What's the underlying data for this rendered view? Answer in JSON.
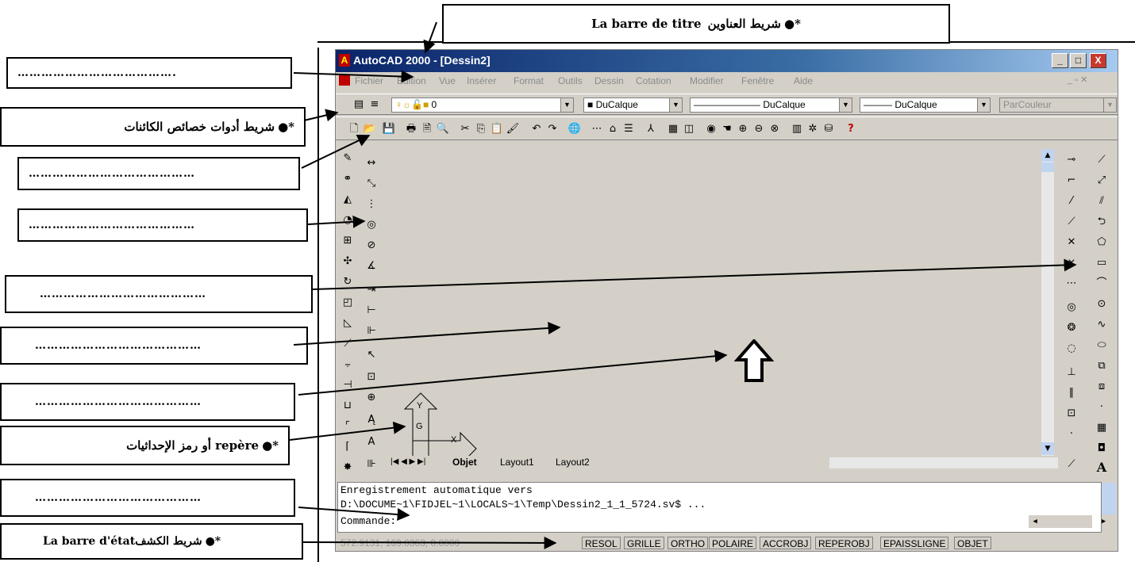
{
  "labels": {
    "title_bar": "La barre de titre",
    "title_bar_ar": "شريط العناوين",
    "object_props": "شريط أدوات خصائص الكائنات",
    "coord": "repère أو رمز الإحداثيات",
    "status_bar": "La barre d'état",
    "status_bar_ar": "شريط الكشف",
    "dots_long": "………………………………….",
    "dots_1": "……………………………………",
    "dots_2": "……………………………………",
    "dots_3": "……………………………………",
    "dots_4": "……………………………………",
    "dots_5": "……………………………………",
    "dots_6": "……………………………………",
    "dots_7": "……………………………………"
  },
  "window": {
    "title": "AutoCAD 2000  - [Dessin2]",
    "min": "_",
    "max": "□",
    "close": "X"
  },
  "menu": [
    "Fichier",
    "Edition",
    "Vue",
    "Insérer",
    "Format",
    "Outils",
    "Dessin",
    "Cotation",
    "Modifier",
    "Fenêtre",
    "Aide"
  ],
  "props": {
    "layer": "0",
    "color": "DuCalque",
    "linetype": "DuCalque",
    "lineweight": "DuCalque",
    "plotstyle": "ParCouleur"
  },
  "tabs": {
    "objet": "Objet",
    "layout1": "Layout1",
    "layout2": "Layout2"
  },
  "ucs": {
    "y": "Y",
    "x": "X",
    "g": "G"
  },
  "command": {
    "line1": "Enregistrement automatique vers",
    "line2": "D:\\DOCUME~1\\FIDJEL~1\\LOCALS~1\\Temp\\Dessin2_1_1_5724.sv$ ...",
    "line3": "Commande:"
  },
  "status": {
    "coords": "572.9131, 169.0363, 0.0000",
    "buttons": [
      "RESOL",
      "GRILLE",
      "ORTHO",
      "POLAIRE",
      "ACCROBJ",
      "REPEROBJ",
      "EPAISSLIGNE",
      "OBJET"
    ]
  }
}
